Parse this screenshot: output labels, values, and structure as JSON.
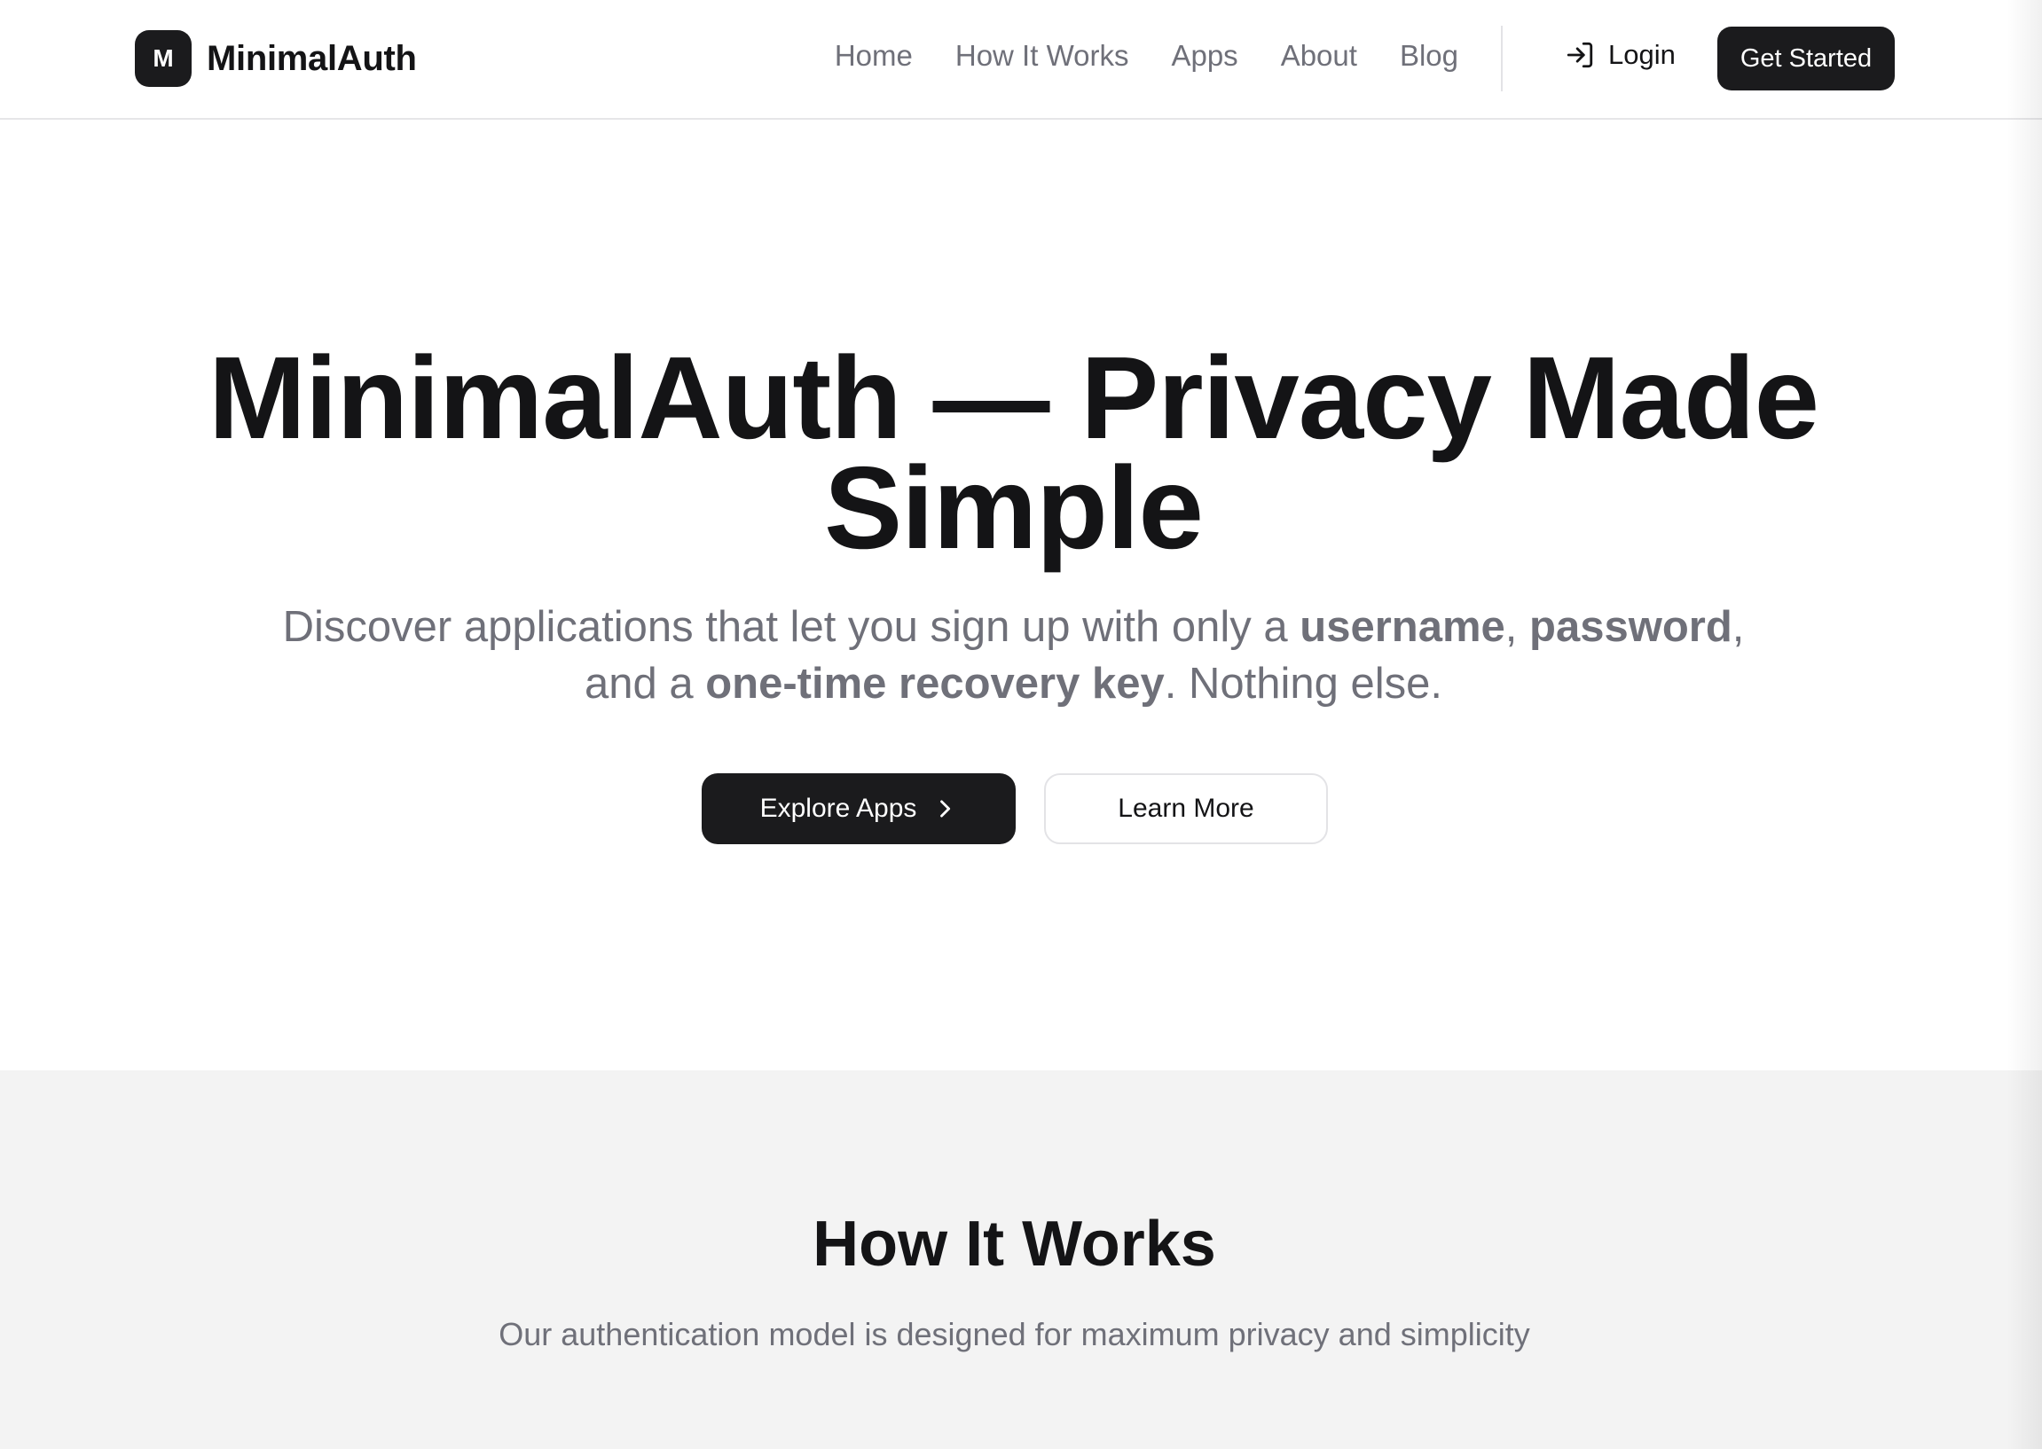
{
  "brand": {
    "mark": "M",
    "name": "MinimalAuth"
  },
  "nav": {
    "links": [
      "Home",
      "How It Works",
      "Apps",
      "About",
      "Blog"
    ],
    "login_label": "Login",
    "cta_label": "Get Started"
  },
  "hero": {
    "title": "MinimalAuth — Privacy Made Simple",
    "subtitle_parts": {
      "p1": "Discover applications that let you sign up with only a ",
      "b1": "username",
      "p2": ", ",
      "b2": "password",
      "p3": ", and a ",
      "b3": "one-time recovery key",
      "p4": ". Nothing else."
    },
    "primary_button": "Explore Apps",
    "secondary_button": "Learn More"
  },
  "how_it_works": {
    "title": "How It Works",
    "subtitle": "Our authentication model is designed for maximum privacy and simplicity"
  },
  "colors": {
    "primary": "#1b1b1d",
    "muted_text": "#6f7079",
    "section_bg": "#f3f3f3"
  },
  "icons": {
    "login": "login-arrow-icon",
    "explore": "chevron-right-icon"
  }
}
